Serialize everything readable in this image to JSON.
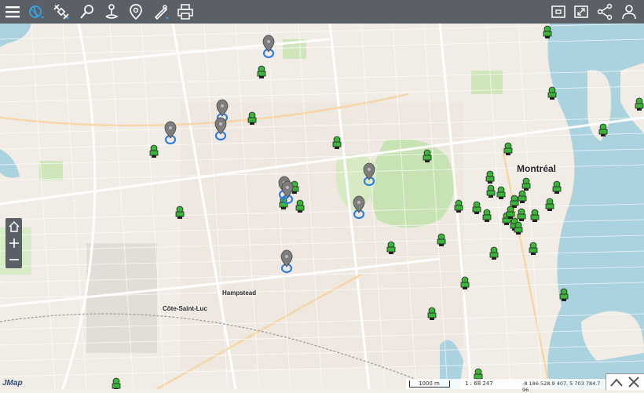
{
  "toolbar": {
    "left_icons": [
      "menu-icon",
      "map-tools-icon",
      "satellite-icon",
      "measure-icon",
      "route-icon",
      "location-pin-icon",
      "edit-tools-icon",
      "print-icon"
    ],
    "right_icons": [
      "minimize-window-icon",
      "fullscreen-icon",
      "share-icon",
      "user-icon"
    ],
    "background": "#5b6066",
    "accent": "#3aa3e3"
  },
  "map": {
    "labels": {
      "city": "Montréal",
      "hampstead": "Hampstead",
      "cote_saint_luc": "Côte-Saint-Luc"
    },
    "water_color": "#aad3df",
    "park_color": "#c8e3b3",
    "marker_color": "#3ab53a",
    "pin_color": "#7d7d7d"
  },
  "controls": {
    "zoom": [
      "home-icon",
      "zoom-in-icon",
      "zoom-out-icon"
    ]
  },
  "scalebar": {
    "distance": "1000 m",
    "scale": "1 : 68 247",
    "coords": "-8 186 528.9 407, 5 703 784.7 96"
  },
  "brand": "JMap"
}
